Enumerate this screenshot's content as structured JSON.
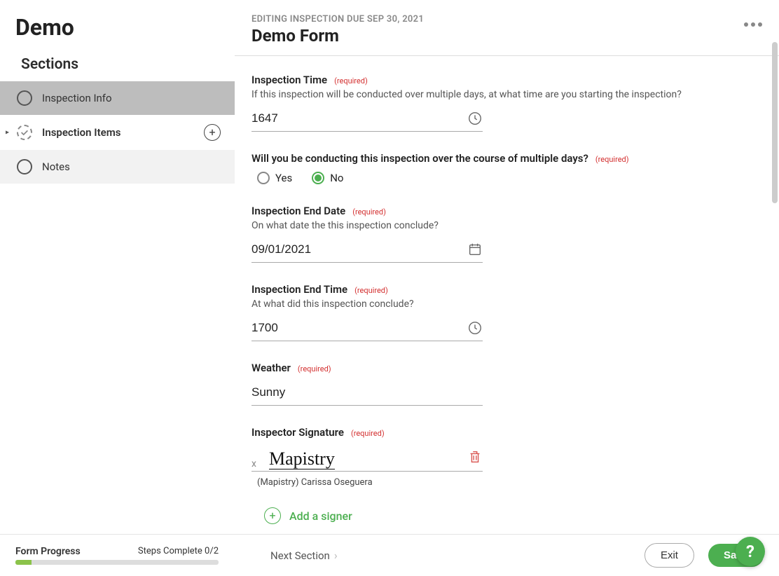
{
  "app_title": "Demo",
  "sidebar": {
    "heading": "Sections",
    "items": [
      {
        "label": "Inspection Info"
      },
      {
        "label": "Inspection Items"
      },
      {
        "label": "Notes"
      }
    ]
  },
  "header": {
    "eyebrow": "EDITING INSPECTION DUE SEP 30, 2021",
    "title": "Demo Form"
  },
  "required_tag": "(required)",
  "fields": {
    "inspection_time": {
      "label": "Inspection Time",
      "help": "If this inspection will be conducted over multiple days, at what time are you starting the inspection?",
      "value": "1647"
    },
    "multi_day": {
      "label": "Will you be conducting this inspection over the course of multiple days?",
      "options": {
        "yes": "Yes",
        "no": "No"
      },
      "selected": "no"
    },
    "end_date": {
      "label": "Inspection End Date",
      "help": "On what date the this inspection conclude?",
      "value": "09/01/2021"
    },
    "end_time": {
      "label": "Inspection End Time",
      "help": "At what did this inspection conclude?",
      "value": "1700"
    },
    "weather": {
      "label": "Weather",
      "value": "Sunny"
    },
    "signature": {
      "label": "Inspector Signature",
      "x_mark": "x",
      "signature_text": "Mapistry",
      "signer_name": "(Mapistry) Carissa Oseguera",
      "add_signer": "Add a signer"
    }
  },
  "footer": {
    "progress_label": "Form Progress",
    "steps_text": "Steps Complete 0/2",
    "next_section": "Next Section",
    "exit": "Exit",
    "save": "Save",
    "help": "?"
  }
}
